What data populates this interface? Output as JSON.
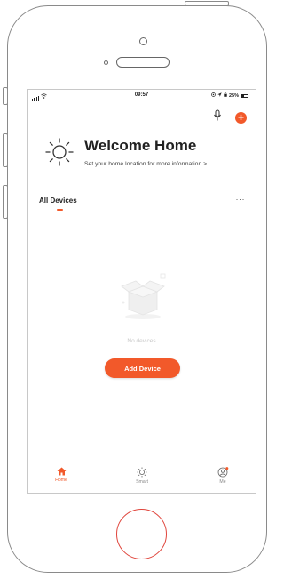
{
  "statusbar": {
    "time": "09:57",
    "battery": "25%"
  },
  "home": {
    "title": "Welcome Home",
    "subtitle": "Set your home location for more information  >",
    "tab_all": "All Devices",
    "more": "···",
    "empty_text": "No devices",
    "add_device_label": "Add Device"
  },
  "tabbar": {
    "items": [
      {
        "label": "Home",
        "icon": "home-icon",
        "active": true
      },
      {
        "label": "Smart",
        "icon": "sun-icon",
        "active": false
      },
      {
        "label": "Me",
        "icon": "profile-icon",
        "active": false
      }
    ]
  },
  "colors": {
    "accent": "#f2592a",
    "home_button_ring": "#e0453c"
  }
}
